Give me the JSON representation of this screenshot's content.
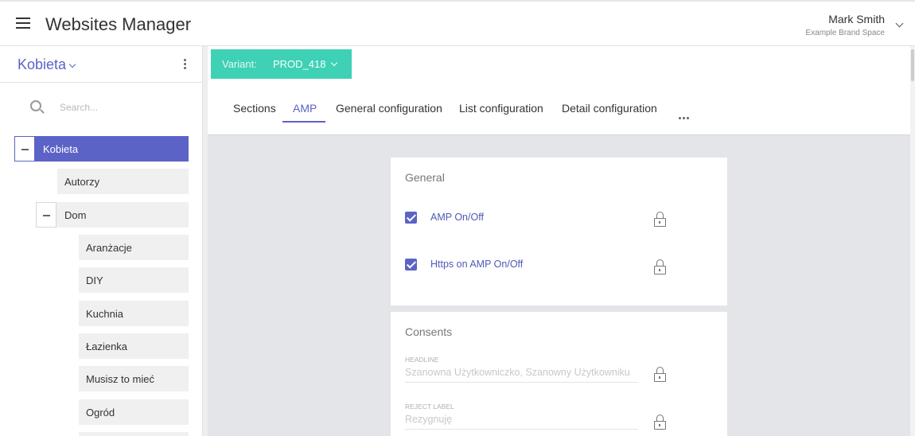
{
  "header": {
    "app_title": "Websites Manager",
    "user_name": "Mark Smith",
    "user_space": "Example Brand Space"
  },
  "sidebar": {
    "title": "Kobieta",
    "search_placeholder": "Search...",
    "tree": [
      {
        "label": "Kobieta",
        "active": true
      },
      {
        "label": "Autorzy"
      },
      {
        "label": "Dom"
      },
      {
        "label": "Aranżacje"
      },
      {
        "label": "DIY"
      },
      {
        "label": "Kuchnia"
      },
      {
        "label": "Łazienka"
      },
      {
        "label": "Musisz to mieć"
      },
      {
        "label": "Ogród"
      }
    ]
  },
  "main": {
    "variant_label": "Variant:",
    "variant_value": "PROD_418",
    "tabs": [
      {
        "label": "Sections"
      },
      {
        "label": "AMP",
        "active": true
      },
      {
        "label": "General configuration"
      },
      {
        "label": "List configuration"
      },
      {
        "label": "Detail configuration"
      }
    ],
    "general": {
      "title": "General",
      "options": [
        {
          "label": "AMP On/Off",
          "checked": true
        },
        {
          "label": "Https on AMP On/Off",
          "checked": true
        }
      ]
    },
    "consents": {
      "title": "Consents",
      "fields": [
        {
          "label": "HEADLINE",
          "value": "Szanowna Użytkowniczko, Szanowny Użytkowniku"
        },
        {
          "label": "REJECT LABEL",
          "value": "Rezygnuję"
        }
      ]
    }
  },
  "colors": {
    "accent": "#5c63c6",
    "variant_bg": "#3ed1b5",
    "content_bg": "#e3e5e8"
  }
}
